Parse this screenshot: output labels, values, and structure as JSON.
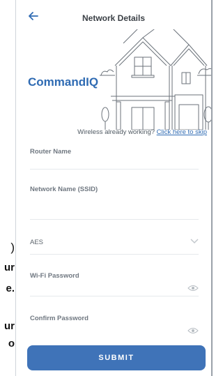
{
  "background_text": {
    "line1": ")",
    "line2": "ur",
    "line3": "e.",
    "line4": "ur",
    "line5": "o"
  },
  "header": {
    "title": "Network Details",
    "back_icon": "arrow-left-icon"
  },
  "hero": {
    "brand": "CommandIQ",
    "illustration": "house-illustration"
  },
  "skip": {
    "prefix": "Wireless already working? ",
    "link": "Click here to skip"
  },
  "form": {
    "router_name": {
      "label": "Router Name",
      "value": ""
    },
    "network_name": {
      "label": "Network Name (SSID)",
      "value": ""
    },
    "encryption": {
      "value": "AES",
      "icon": "chevron-down-icon"
    },
    "wifi_password": {
      "label": "Wi-Fi Password",
      "value": "",
      "icon": "eye-icon"
    },
    "confirm_password": {
      "label": "Confirm Password",
      "value": "",
      "icon": "eye-icon"
    }
  },
  "submit": {
    "label": "SUBMIT"
  },
  "colors": {
    "accent": "#2f6bb3",
    "button": "#3f73b8"
  }
}
